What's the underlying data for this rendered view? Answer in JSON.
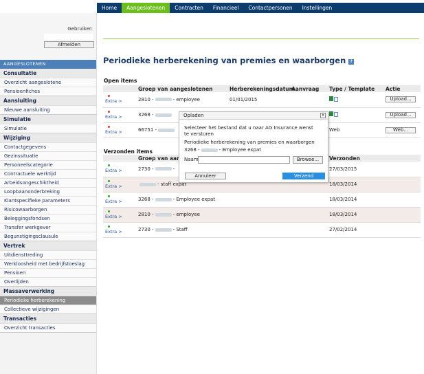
{
  "topnav": {
    "items": [
      {
        "label": "Home",
        "active": false
      },
      {
        "label": "Aangeslotenen",
        "active": true
      },
      {
        "label": "Contracten",
        "active": false
      },
      {
        "label": "Financieel",
        "active": false
      },
      {
        "label": "Contactpersonen",
        "active": false
      },
      {
        "label": "Instellingen",
        "active": false
      }
    ],
    "bar_color": "#0c3c6e",
    "active_color": "#6dbd1f"
  },
  "user": {
    "label": "Gebruiker:",
    "logout_label": "Afmelden"
  },
  "sidebar": {
    "header": "AANGESLOTENEN",
    "sections": [
      {
        "title": "Consultatie",
        "items": [
          "Overzicht aangeslotene",
          "Pensioenfiches"
        ]
      },
      {
        "title": "Aansluiting",
        "items": [
          "Nieuwe aansluiting"
        ]
      },
      {
        "title": "Simulatie",
        "items": [
          "Simulatie"
        ]
      },
      {
        "title": "Wijziging",
        "items": [
          "Contactgegevens",
          "Gezinssituatie",
          "Personeelscategorie",
          "Contractuele werktijd",
          "Arbeidsongeschiktheid",
          "Loopbaanonderbreking",
          "Klantspecifieke parameters",
          "Risicowaarborgen",
          "Beleggingsfondsen",
          "Transfer werkgever",
          "Begunstigingsclausule"
        ]
      },
      {
        "title": "Vertrek",
        "items": [
          "Uitdiensttreding",
          "Werkloosheid met bedrijfstoeslag",
          "Pensioen",
          "Overlijden"
        ]
      },
      {
        "title": "Massaverwerking",
        "items": [
          "Periodieke herberekening",
          "Collectieve wijzigingen"
        ]
      },
      {
        "title": "Transacties",
        "items": [
          "Overzicht transacties"
        ]
      }
    ],
    "active_item": "Periodieke herberekening"
  },
  "page": {
    "title": "Periodieke herberekening van premies en waarborgen",
    "help_icon": "help-icon"
  },
  "open_items": {
    "title": "Open items",
    "headers": [
      "",
      "Groep van aangeslotenen",
      "Herberekeningsdatum",
      "Aanvraag",
      "Type / Template",
      "Actie"
    ],
    "rows": [
      {
        "extra": "Extra >",
        "group_prefix": "2810 -",
        "group_suffix": "- employee",
        "date": "01/01/2015",
        "aanvraag": "",
        "type": "",
        "action": "Upload..."
      },
      {
        "extra": "Extra >",
        "group_prefix": "3268 -",
        "group_suffix": "",
        "date": "",
        "aanvraag": "",
        "type": "",
        "action": "Upload..."
      },
      {
        "extra": "Extra >",
        "group_prefix": "66751 -",
        "group_suffix": "",
        "date": "",
        "aanvraag": "",
        "type": "Web",
        "action": "Web..."
      }
    ]
  },
  "sent_items": {
    "title": "Verzonden items",
    "headers": [
      "",
      "Groep van aang",
      "",
      "",
      "Verzonden"
    ],
    "rows": [
      {
        "extra": "Extra >",
        "group_prefix": "2730 -",
        "group_suffix": "-",
        "sent": "27/03/2015"
      },
      {
        "extra": "Extra >",
        "group_prefix": "",
        "group_suffix": "- staff expat",
        "sent": "18/03/2014"
      },
      {
        "extra": "Extra >",
        "group_prefix": "3268 -",
        "group_suffix": "- Employee expat",
        "sent": "18/03/2014"
      },
      {
        "extra": "Extra >",
        "group_prefix": "2810 -",
        "group_suffix": "- employee",
        "sent": "18/03/2014"
      },
      {
        "extra": "Extra >",
        "group_prefix": "2730 -",
        "group_suffix": "- Staff",
        "sent": "27/02/2014"
      }
    ]
  },
  "dialog": {
    "title": "Opladen",
    "close_glyph": "x",
    "line1": "Selecteer het bestand dat u naar AG Insurance wenst",
    "line2": "te versturen",
    "line3": "Periodieke herberekening van premies en waarborgen",
    "line4_prefix": "3268 -",
    "line4_suffix": "- Employee expat",
    "name_label": "Naam",
    "browse_label": "Browse...",
    "cancel_label": "Annuleer",
    "send_label": "Verzend",
    "send_color": "#2a8fe0"
  }
}
